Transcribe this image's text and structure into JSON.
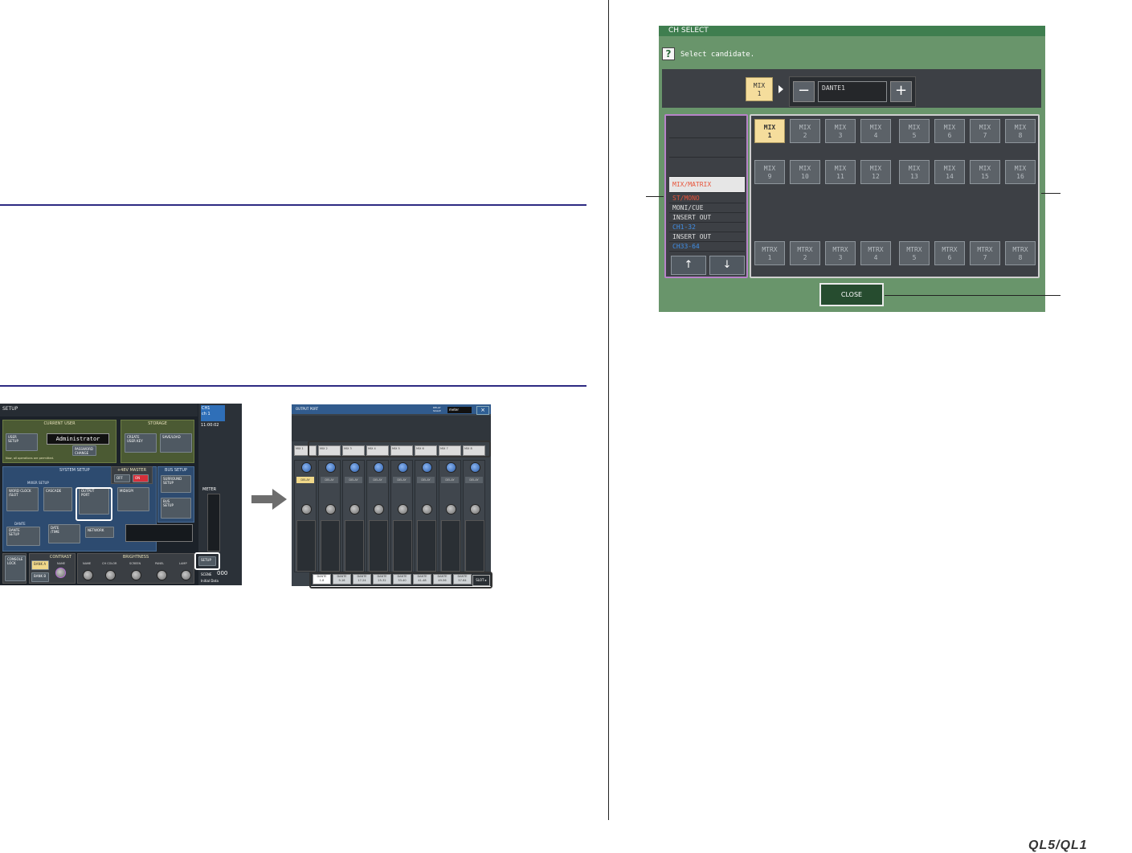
{
  "setup_screen": {
    "title": "SETUP",
    "current_user_title": "CURRENT USER",
    "storage_title": "STORAGE",
    "user_setup": "USER\nSETUP",
    "user_name": "Administrator",
    "create_user_key": "CREATE\nUSER KEY",
    "save_load": "SAVE/LOAD",
    "password_change": "PASSWORD\nCHANGE",
    "permitted_msg": "Now, all operations are permitted.",
    "system_setup_title": "SYSTEM SETUP",
    "phantom_title": "+48V MASTER",
    "phantom_off": "OFF",
    "phantom_on": "ON",
    "bus_setup_title": "BUS SETUP",
    "surround_setup": "SURROUND\nSETUP",
    "mixer_setup_title": "MIXER SETUP",
    "word_clock": "WORD CLOCK\n/SLOT",
    "cascade": "CASCADE",
    "output_port": "OUTPUT\nPORT",
    "midi_gpi": "MIDI/GPI",
    "bus_setup": "BUS\nSETUP",
    "dante_title": "DANTE",
    "dante_setup": "DANTE\nSETUP",
    "date_time": "DATE\n/TIME",
    "network": "NETWORK",
    "console_lock": "CONSOLE\nLOCK",
    "contrast_title": "CONTRAST",
    "brightness_title": "BRIGHTNESS",
    "bank_a": "BANK A",
    "bank_b": "BANK B",
    "name_label": "NAME",
    "ch_color_label": "CH COLOR",
    "screen_label": "SCREEN",
    "panel_label": "PANEL",
    "lamp_label": "LAMP",
    "ch_name": "CH1\nch 1",
    "time": "11:00:02",
    "meter_label": "METER",
    "setup_btn": "SETUP",
    "scene_label": "SCENE",
    "scene_number": "000",
    "scene_title": "Initial Data"
  },
  "output_port_screen": {
    "title": "OUTPUT PORT",
    "delay_scale": "DELAY\nSCALE",
    "delay_unit": "meter",
    "close_icon": "×",
    "mix_buttons": [
      "MIX 1",
      "MIX 2",
      "MIX 3",
      "MIX 4",
      "MIX 5",
      "MIX 6",
      "MIX 7",
      "MIX 8"
    ],
    "delay_label": "DELAY",
    "dante_tabs": [
      "DANTE\n1-8",
      "DANTE\n9-16",
      "DANTE\n17-24",
      "DANTE\n25-32",
      "DANTE\n33-40",
      "DANTE\n41-48",
      "DANTE\n49-56",
      "DANTE\n57-64"
    ],
    "slot_tab": "SLOT ▸"
  },
  "ch_select": {
    "title": "CH SELECT",
    "help_icon": "?",
    "prompt": "Select candidate.",
    "current_channel": "MIX\n1",
    "minus": "−",
    "plus": "+",
    "port_value": "DANTE1",
    "categories": [
      {
        "label": "",
        "color": "#dedede"
      },
      {
        "label": "",
        "color": "#dedede"
      },
      {
        "label": "",
        "color": "#dedede"
      },
      {
        "label": "MIX/MATRIX",
        "color": "#e8543a"
      },
      {
        "label": "ST/MONO",
        "color": "#e8543a"
      },
      {
        "label": "MONI/CUE",
        "color": "#dedede"
      },
      {
        "label": "INSERT OUT",
        "color": "#dedede"
      },
      {
        "label": "CH1-32",
        "color": "#3f8ee6"
      },
      {
        "label": "INSERT OUT",
        "color": "#dedede"
      },
      {
        "label": "CH33-64",
        "color": "#3f8ee6"
      }
    ],
    "up_icon": "↑",
    "down_icon": "↓",
    "mix_row1": [
      "MIX\n1",
      "MIX\n2",
      "MIX\n3",
      "MIX\n4",
      "MIX\n5",
      "MIX\n6",
      "MIX\n7",
      "MIX\n8"
    ],
    "mix_row2": [
      "MIX\n9",
      "MIX\n10",
      "MIX\n11",
      "MIX\n12",
      "MIX\n13",
      "MIX\n14",
      "MIX\n15",
      "MIX\n16"
    ],
    "mtrx_row": [
      "MTRX\n1",
      "MTRX\n2",
      "MTRX\n3",
      "MTRX\n4",
      "MTRX\n5",
      "MTRX\n6",
      "MTRX\n7",
      "MTRX\n8"
    ],
    "selected": "MIX 1",
    "close_label": "CLOSE"
  },
  "footer_brand": "QL5/QL1"
}
